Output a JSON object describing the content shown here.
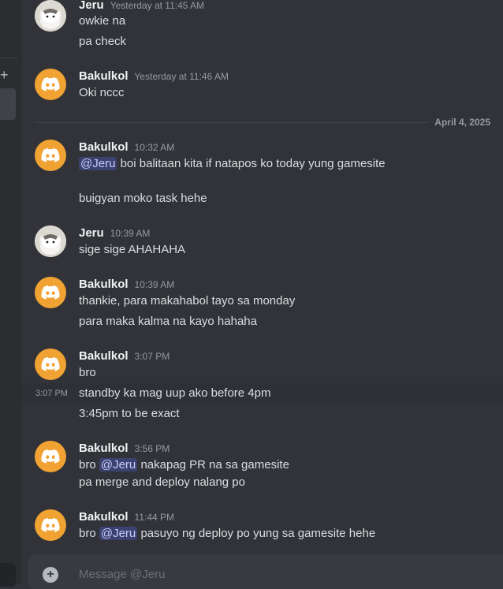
{
  "sidebar": {
    "add_glyph": "+"
  },
  "messages": [
    {
      "author": "Jeru",
      "time": "Yesterday at 11:45 AM",
      "lines": [
        "owkie na",
        "pa check"
      ]
    },
    {
      "author": "Bakulkol",
      "time": "Yesterday at 11:46 AM",
      "lines": [
        "Oki nccc"
      ]
    },
    {
      "author": "Bakulkol",
      "time": "10:32 AM",
      "mention": "@Jeru",
      "lines": [
        "boi balitaan kita if natapos ko today yung gamesite",
        "buigyan moko task hehe"
      ]
    },
    {
      "author": "Jeru",
      "time": "10:39 AM",
      "lines": [
        "sige sige AHAHAHA"
      ]
    },
    {
      "author": "Bakulkol",
      "time": "10:39 AM",
      "lines": [
        "thankie, para makahabol tayo sa monday",
        "para maka kalma na kayo hahaha"
      ]
    },
    {
      "author": "Bakulkol",
      "time": "3:07 PM",
      "hover_time": "3:07 PM",
      "lines": [
        "bro",
        "standby ka mag uup ako before 4pm",
        "3:45pm to be exact"
      ]
    },
    {
      "author": "Bakulkol",
      "time": "3:56 PM",
      "mention": "@Jeru",
      "lines": [
        "bro",
        "nakapag PR na sa gamesite",
        "pa merge and deploy nalang po"
      ]
    },
    {
      "author": "Bakulkol",
      "time": "11:44 PM",
      "mention": "@Jeru",
      "lines": [
        "bro",
        "pasuyo ng deploy po yung sa gamesite hehe"
      ]
    }
  ],
  "date_divider": "April 4, 2025",
  "composer": {
    "placeholder": "Message @Jeru"
  },
  "colors": {
    "accent": "#f0a232",
    "mention_bg": "#3c4270",
    "background": "#313338"
  }
}
